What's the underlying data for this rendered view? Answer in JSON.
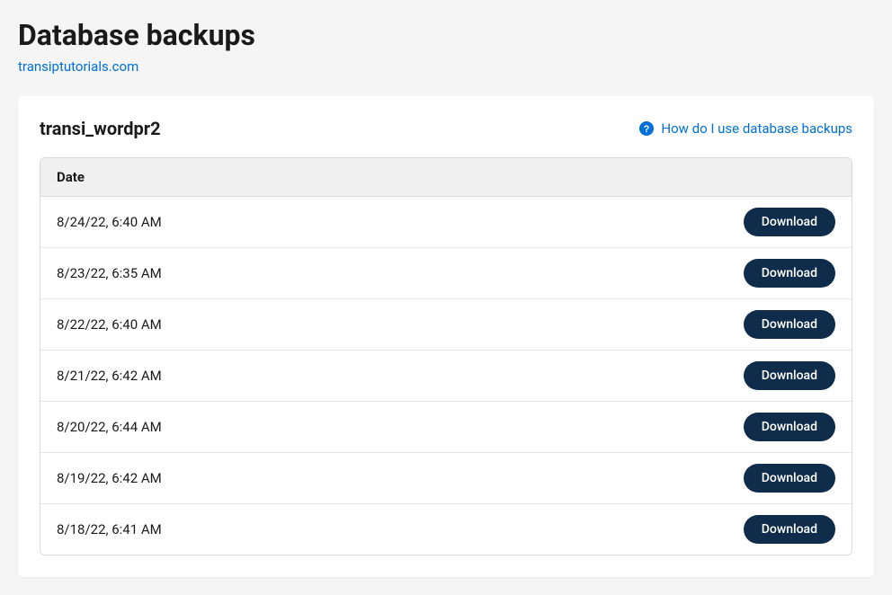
{
  "page": {
    "title": "Database backups",
    "breadcrumb": "transiptutorials.com"
  },
  "card": {
    "title": "transi_wordpr2",
    "help_link": "How do I use database backups"
  },
  "table": {
    "column_header": "Date",
    "download_label": "Download",
    "rows": [
      {
        "date": "8/24/22, 6:40 AM"
      },
      {
        "date": "8/23/22, 6:35 AM"
      },
      {
        "date": "8/22/22, 6:40 AM"
      },
      {
        "date": "8/21/22, 6:42 AM"
      },
      {
        "date": "8/20/22, 6:44 AM"
      },
      {
        "date": "8/19/22, 6:42 AM"
      },
      {
        "date": "8/18/22, 6:41 AM"
      }
    ]
  }
}
